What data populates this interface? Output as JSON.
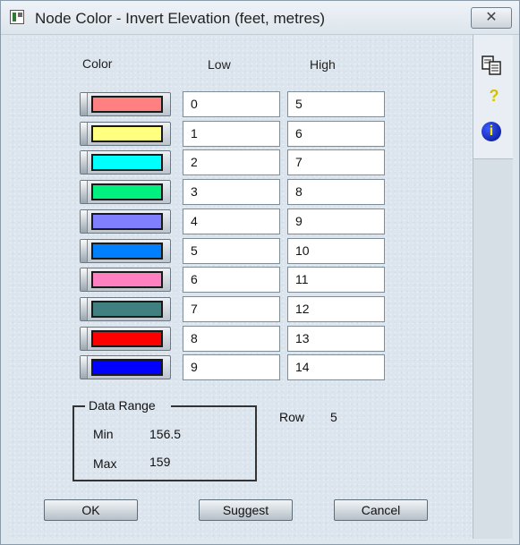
{
  "window": {
    "title": "Node Color - Invert Elevation (feet, metres)",
    "close_glyph": "✕"
  },
  "side_icons": [
    {
      "name": "copy-icon"
    },
    {
      "name": "help-icon",
      "glyph": "?"
    },
    {
      "name": "info-icon",
      "glyph": "i"
    }
  ],
  "headers": {
    "color": "Color",
    "low": "Low",
    "high": "High"
  },
  "rows": [
    {
      "color": "#ff8080",
      "low": "0",
      "high": "5"
    },
    {
      "color": "#ffff80",
      "low": "1",
      "high": "6"
    },
    {
      "color": "#00ffff",
      "low": "2",
      "high": "7"
    },
    {
      "color": "#00f080",
      "low": "3",
      "high": "8"
    },
    {
      "color": "#8080ff",
      "low": "4",
      "high": "9"
    },
    {
      "color": "#0080ff",
      "low": "5",
      "high": "10"
    },
    {
      "color": "#ff80c0",
      "low": "6",
      "high": "11"
    },
    {
      "color": "#408080",
      "low": "7",
      "high": "12"
    },
    {
      "color": "#ff0000",
      "low": "8",
      "high": "13"
    },
    {
      "color": "#0000ff",
      "low": "9",
      "high": "14"
    }
  ],
  "data_range": {
    "title": "Data Range",
    "min_label": "Min",
    "min_value": "156.5",
    "max_label": "Max",
    "max_value": "159"
  },
  "row_info": {
    "label": "Row",
    "value": "5"
  },
  "buttons": {
    "ok": "OK",
    "suggest": "Suggest",
    "cancel": "Cancel"
  }
}
